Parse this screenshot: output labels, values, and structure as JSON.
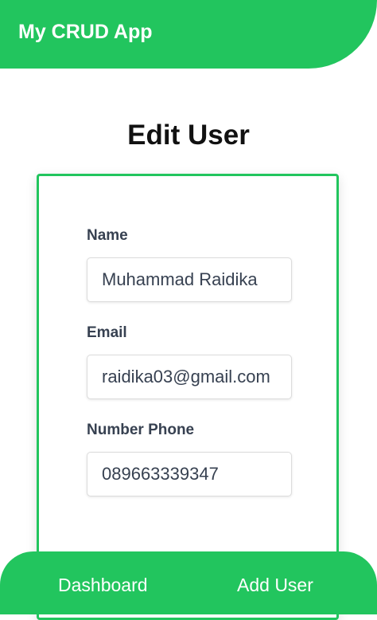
{
  "header": {
    "app_title": "My CRUD App"
  },
  "page": {
    "title": "Edit User"
  },
  "form": {
    "name_label": "Name",
    "name_value": "Muhammad Raidika",
    "email_label": "Email",
    "email_value": "raidika03@gmail.com",
    "phone_label": "Number Phone",
    "phone_value": "089663339347"
  },
  "footer": {
    "nav": [
      {
        "label": "Dashboard"
      },
      {
        "label": "Add User"
      }
    ]
  },
  "colors": {
    "accent": "#22c55e",
    "label_text": "#374151",
    "background": "#ffffff"
  }
}
